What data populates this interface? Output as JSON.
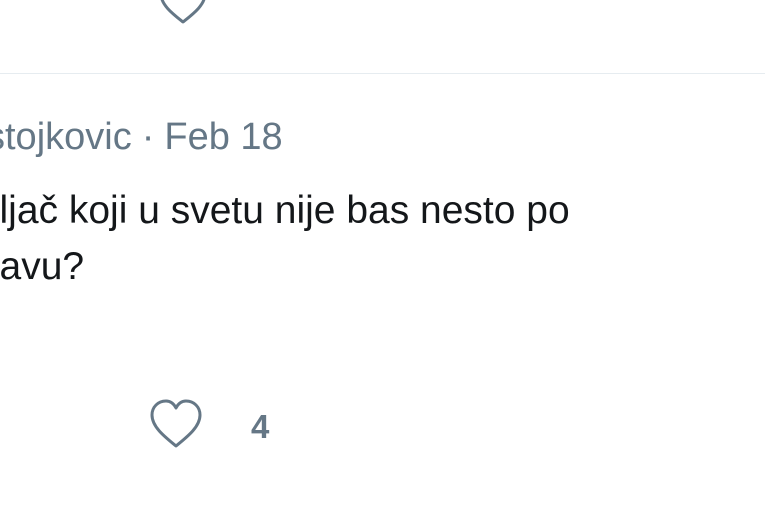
{
  "previous_reply": {
    "like_icon": "heart-outline-icon"
  },
  "reply": {
    "author_handle": "stojkovic",
    "separator": "·",
    "date": "Feb 18",
    "text_lines": [
      "vljač koji u svetu nije bas nesto po",
      "zavu?"
    ],
    "like_icon": "heart-outline-icon",
    "like_count": "4"
  },
  "colors": {
    "muted_text": "#657786",
    "body_text": "#14171a",
    "divider": "#e6ecf0",
    "icon_stroke": "#657786"
  }
}
